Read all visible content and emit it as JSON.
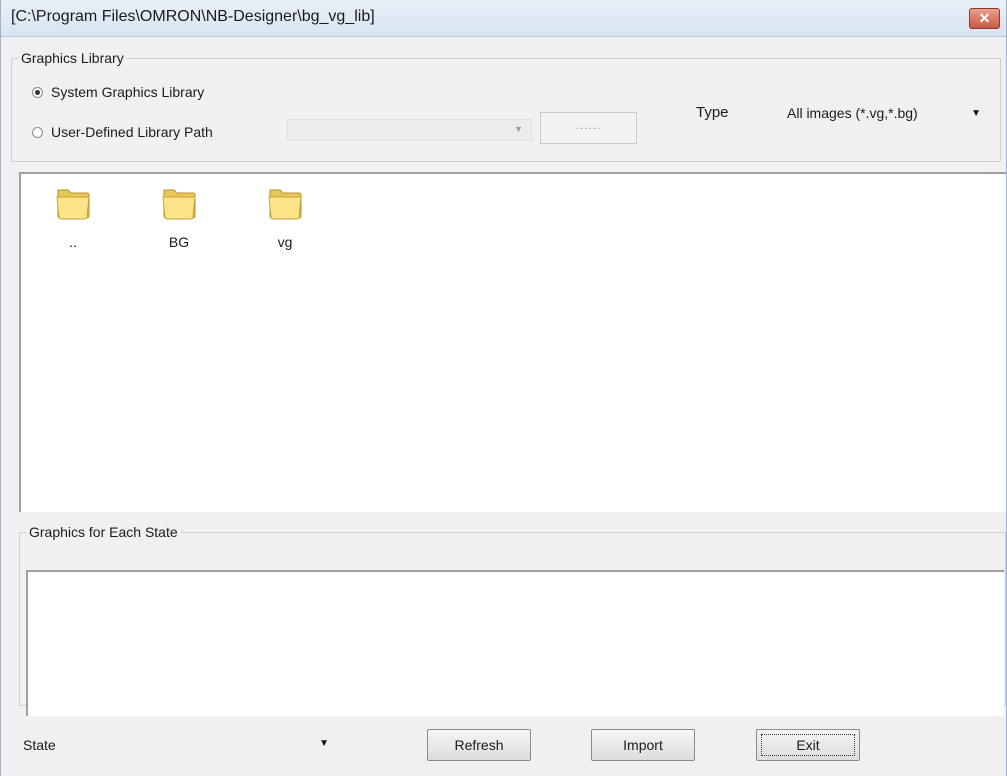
{
  "window": {
    "title": "[C:\\Program Files\\OMRON\\NB-Designer\\bg_vg_lib]",
    "close_label": "✕"
  },
  "library": {
    "group_label": "Graphics Library",
    "system_option": "System Graphics Library",
    "system_selected": true,
    "user_option": "User-Defined Library Path",
    "path_value": "",
    "browse_label": "......",
    "type_label": "Type",
    "type_value": "All images (*.vg,*.bg)"
  },
  "files": {
    "items": [
      {
        "name": "..",
        "icon": "folder-icon"
      },
      {
        "name": "BG",
        "icon": "folder-icon"
      },
      {
        "name": "vg",
        "icon": "folder-icon"
      }
    ]
  },
  "states": {
    "group_label": "Graphics for Each State"
  },
  "footer": {
    "state_label": "State",
    "state_value": "",
    "refresh_label": "Refresh",
    "import_label": "Import",
    "exit_label": "Exit"
  }
}
